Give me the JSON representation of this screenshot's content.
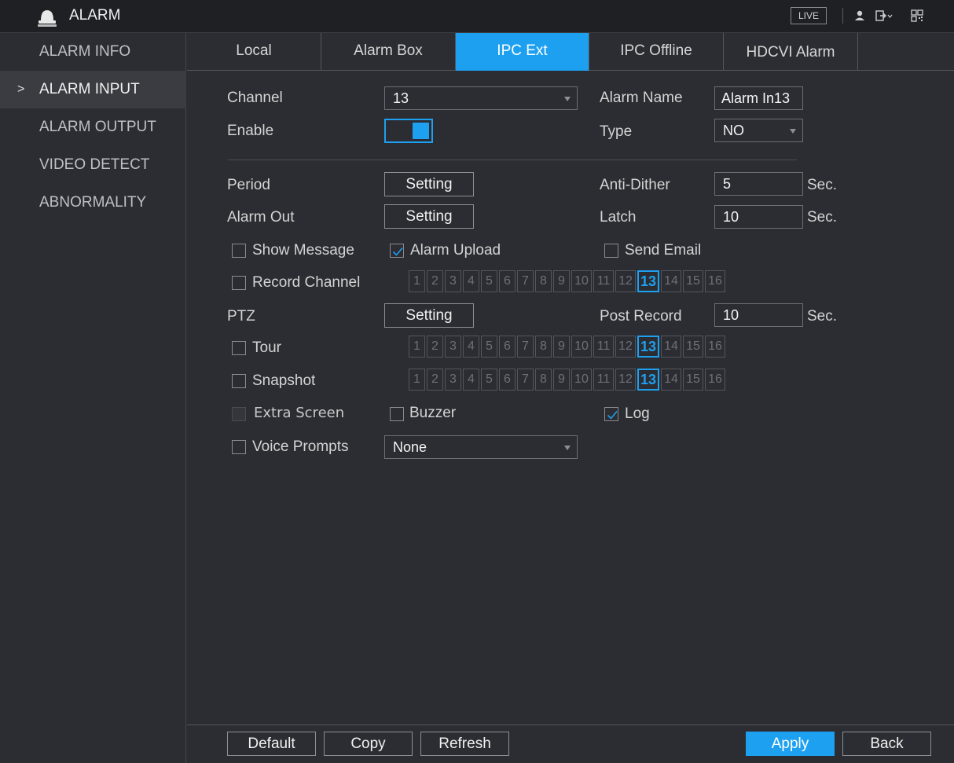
{
  "title": "ALARM",
  "header": {
    "live_label": "LIVE"
  },
  "sidebar": {
    "items": [
      {
        "label": "ALARM INFO"
      },
      {
        "label": "ALARM INPUT",
        "active": true,
        "arrow": ">"
      },
      {
        "label": "ALARM OUTPUT"
      },
      {
        "label": "VIDEO DETECT"
      },
      {
        "label": "ABNORMALITY"
      }
    ]
  },
  "tabs": [
    {
      "label": "Local"
    },
    {
      "label": "Alarm Box"
    },
    {
      "label": "IPC Ext",
      "active": true
    },
    {
      "label": "IPC Offline"
    },
    {
      "label": "HDCVI Alarm"
    }
  ],
  "form": {
    "channel": {
      "label": "Channel",
      "value": "13"
    },
    "alarm_name": {
      "label": "Alarm Name",
      "value": "Alarm In13"
    },
    "enable": {
      "label": "Enable",
      "on": true
    },
    "type": {
      "label": "Type",
      "value": "NO"
    },
    "period": {
      "label": "Period",
      "button": "Setting"
    },
    "anti_dither": {
      "label": "Anti-Dither",
      "value": "5",
      "unit": "Sec."
    },
    "alarm_out": {
      "label": "Alarm Out",
      "button": "Setting"
    },
    "latch": {
      "label": "Latch",
      "value": "10",
      "unit": "Sec."
    },
    "show_message": {
      "label": "Show Message",
      "checked": false
    },
    "alarm_upload": {
      "label": "Alarm Upload",
      "checked": true
    },
    "send_email": {
      "label": "Send Email",
      "checked": false
    },
    "record_channel": {
      "label": "Record Channel",
      "checked": false
    },
    "ptz": {
      "label": "PTZ",
      "button": "Setting"
    },
    "post_record": {
      "label": "Post Record",
      "value": "10",
      "unit": "Sec."
    },
    "tour": {
      "label": "Tour",
      "checked": false
    },
    "snapshot": {
      "label": "Snapshot",
      "checked": false
    },
    "extra_screen": {
      "label": "Extra Screen",
      "checked": false,
      "disabled": true
    },
    "buzzer": {
      "label": "Buzzer",
      "checked": false
    },
    "log": {
      "label": "Log",
      "checked": true
    },
    "voice_prompts": {
      "label": "Voice Prompts",
      "checked": false,
      "value": "None"
    }
  },
  "channel_grid": {
    "channels": [
      "1",
      "2",
      "3",
      "4",
      "5",
      "6",
      "7",
      "8",
      "9",
      "10",
      "11",
      "12",
      "13",
      "14",
      "15",
      "16"
    ],
    "selected": "13"
  },
  "footer": {
    "default_label": "Default",
    "copy_label": "Copy",
    "refresh_label": "Refresh",
    "apply_label": "Apply",
    "back_label": "Back"
  },
  "colors": {
    "accent": "#1ea0f0",
    "background": "#2c2d33",
    "titlebar": "#1f2024"
  }
}
